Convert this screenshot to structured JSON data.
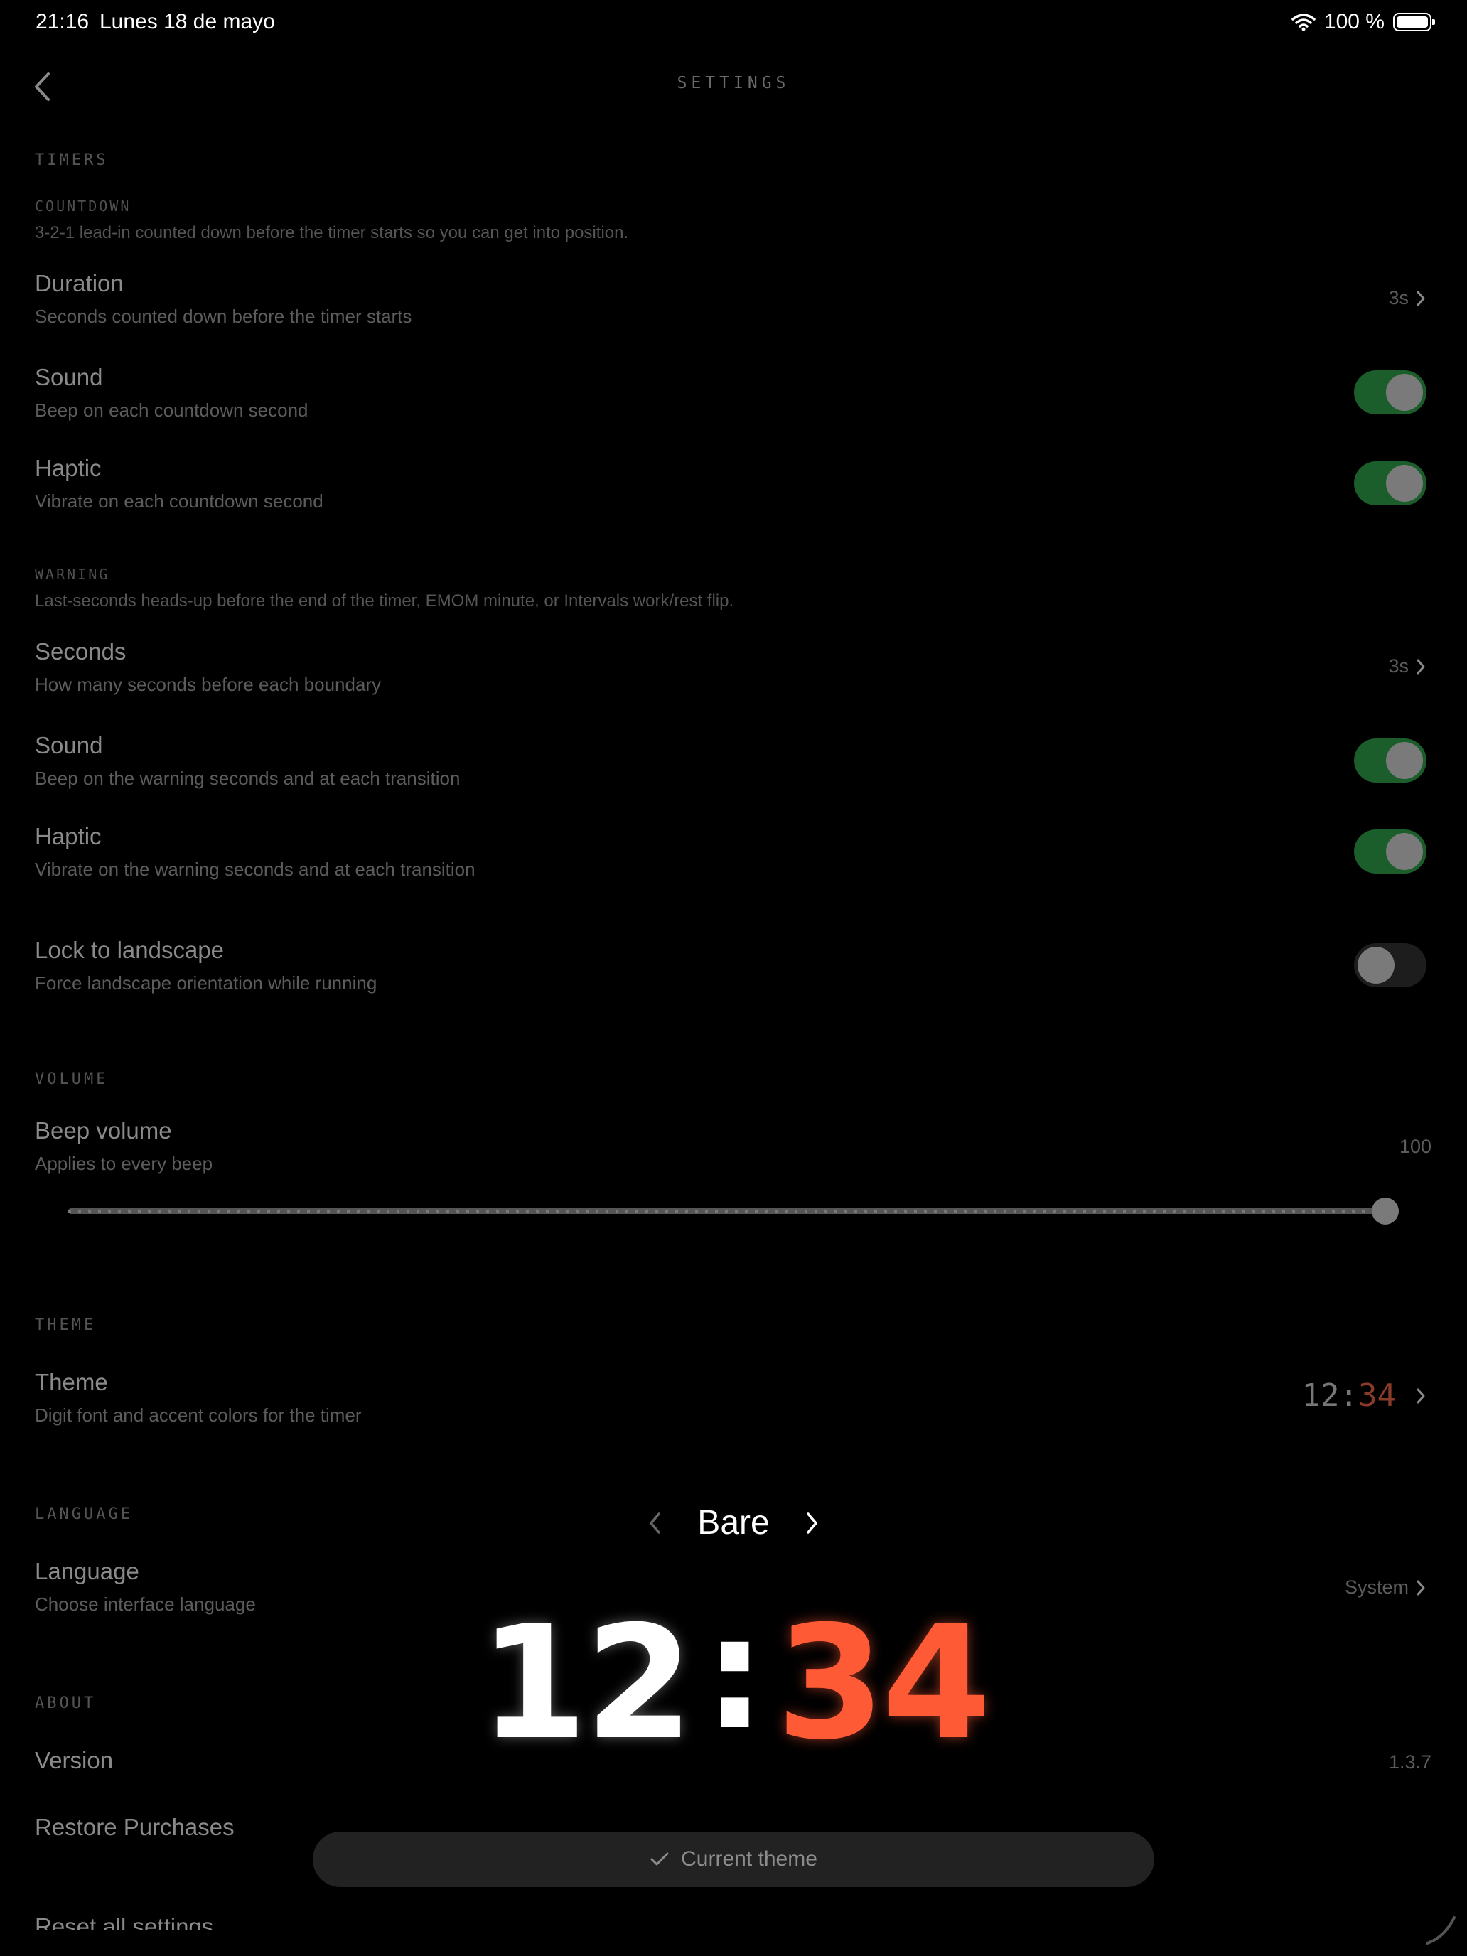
{
  "status_bar": {
    "time": "21:16",
    "date": "Lunes 18 de mayo",
    "battery": "100 %"
  },
  "nav": {
    "title": "SETTINGS"
  },
  "sections": {
    "timers": "TIMERS",
    "countdown": {
      "label": "COUNTDOWN",
      "description": "3-2-1 lead-in counted down before the timer starts so you can get into position.",
      "duration": {
        "title": "Duration",
        "subtitle": "Seconds counted down before the timer starts",
        "value": "3s"
      },
      "sound": {
        "title": "Sound",
        "subtitle": "Beep on each countdown second",
        "on": true
      },
      "haptic": {
        "title": "Haptic",
        "subtitle": "Vibrate on each countdown second",
        "on": true
      }
    },
    "warning": {
      "label": "WARNING",
      "description": "Last-seconds heads-up before the end of the timer, EMOM minute, or Intervals work/rest flip.",
      "seconds": {
        "title": "Seconds",
        "subtitle": "How many seconds before each boundary",
        "value": "3s"
      },
      "sound": {
        "title": "Sound",
        "subtitle": "Beep on the warning seconds and at each transition",
        "on": true
      },
      "haptic": {
        "title": "Haptic",
        "subtitle": "Vibrate on the warning seconds and at each transition",
        "on": true
      }
    },
    "lock_landscape": {
      "title": "Lock to landscape",
      "subtitle": "Force landscape orientation while running",
      "on": false
    },
    "volume": {
      "label": "VOLUME",
      "title": "Beep volume",
      "subtitle": "Applies to every beep",
      "value": "100",
      "level": 1.0
    },
    "theme": {
      "label": "THEME",
      "title": "Theme",
      "subtitle": "Digit font and accent colors for the timer",
      "preview_hours": "12",
      "preview_colon": ":",
      "preview_minutes": "34"
    },
    "language": {
      "label": "LANGUAGE",
      "title": "Language",
      "subtitle": "Choose interface language",
      "value": "System"
    },
    "about": {
      "label": "ABOUT",
      "version_title": "Version",
      "version_value": "1.3.7",
      "restore": "Restore Purchases",
      "reset": "Reset all settings"
    }
  },
  "theme_overlay": {
    "name": "Bare",
    "hours": "12",
    "colon": ":",
    "minutes": "34",
    "current_button": "Current theme"
  },
  "colors": {
    "accent": "#ff5a36",
    "toggle_on": "#1b5e2c",
    "background": "#000000"
  },
  "icons": {
    "back": "chevron-left-icon",
    "row_chevron": "chevron-right-icon",
    "prev_theme": "chevron-left-icon",
    "next_theme": "chevron-right-icon",
    "current": "checkmark-icon",
    "wifi": "wifi-icon",
    "battery": "battery-icon"
  }
}
